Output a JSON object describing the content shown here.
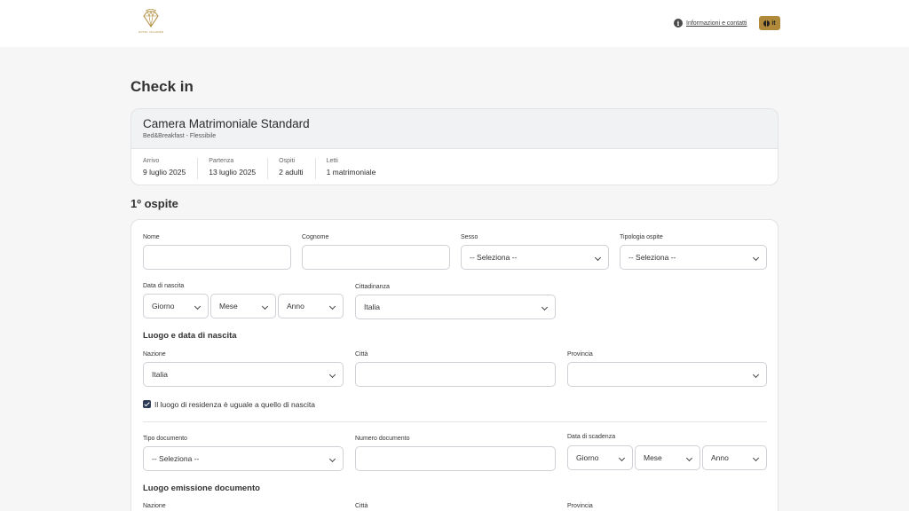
{
  "header": {
    "brand_text": "HOTEL VALADIER",
    "info_link": "Informazioni e contatti",
    "language": "it",
    "icons": [
      "diamond-logo",
      "info-icon",
      "globe-icon"
    ],
    "accent_color": "#b08a3a"
  },
  "page_title": "Check in",
  "room": {
    "name": "Camera Matrimoniale Standard",
    "subtitle": "Bed&Breakfast - Flessibile",
    "stats": [
      {
        "label": "Arrivo",
        "value": "9 luglio 2025"
      },
      {
        "label": "Partenza",
        "value": "13 luglio 2025"
      },
      {
        "label": "Ospiti",
        "value": "2 adulti"
      },
      {
        "label": "Letti",
        "value": "1 matrimoniale"
      }
    ]
  },
  "guest": {
    "title": "1º ospite",
    "nome_label": "Nome",
    "nome_value": "",
    "cognome_label": "Cognome",
    "cognome_value": "",
    "sesso_label": "Sesso",
    "sesso_value": "-- Seleziona --",
    "tipologia_label": "Tipologia ospite",
    "tipologia_value": "-- Seleziona --",
    "nascita_label": "Data di nascita",
    "giorno": "Giorno",
    "mese": "Mese",
    "anno": "Anno",
    "cittadinanza_label": "Cittadinanza",
    "cittadinanza_value": "Italia",
    "luogo_nascita_title": "Luogo e data di nascita",
    "nazione_label": "Nazione",
    "nazione_value": "Italia",
    "citta_label": "Città",
    "citta_value": "",
    "provincia_label": "Provincia",
    "provincia_value": "",
    "residenza_checkbox": "Il luogo di residenza è uguale a quello di nascita",
    "residenza_checked": true,
    "tipo_doc_label": "Tipo documento",
    "tipo_doc_value": "-- Seleziona --",
    "numero_doc_label": "Numero documento",
    "numero_doc_value": "",
    "scadenza_label": "Data di scadenza",
    "emissione_title": "Luogo emissione documento",
    "em_nazione_label": "Nazione",
    "em_citta_label": "Città",
    "em_provincia_label": "Provincia"
  }
}
